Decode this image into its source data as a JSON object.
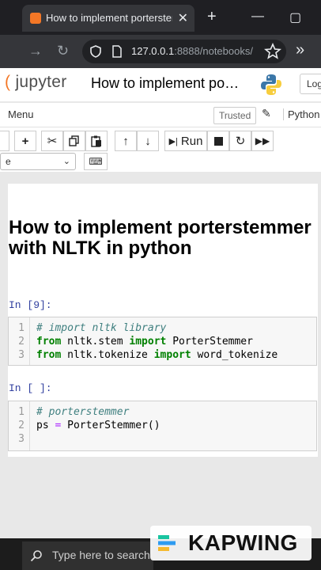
{
  "browser": {
    "tab_title": "How to implement porterstemn",
    "tab_close": "✕",
    "new_tab": "+",
    "minimize": "—",
    "maximize": "▢",
    "url_host": "127.0.0.1",
    "url_rest": ":8888/notebooks/",
    "more": "»"
  },
  "jupyter": {
    "logo_text": "jupyter",
    "notebook_title": "How to implement po…",
    "logout_label": "Log",
    "menu_label": "Menu",
    "trusted_label": "Trusted",
    "kernel_label": "Python",
    "toolbar": {
      "run_label": "Run",
      "celltype_value": "e"
    }
  },
  "notebook": {
    "heading": "How to implement porterstemmer with NLTK in python",
    "cell1": {
      "prompt": "In [9]:",
      "lines": [
        {
          "n": "1",
          "comment": "# import nltk library"
        },
        {
          "n": "2",
          "kw1": "from",
          "mid1": " nltk.stem ",
          "kw2": "import",
          "rest": " PorterStemmer"
        },
        {
          "n": "3",
          "kw1": "from",
          "mid1": " nltk.tokenize ",
          "kw2": "import",
          "rest": " word_tokenize"
        }
      ]
    },
    "cell2": {
      "prompt": "In [ ]:",
      "lines": [
        {
          "n": "1",
          "comment": "# porterstemmer"
        },
        {
          "n": "2",
          "pre": "ps ",
          "op": "=",
          "rest": " PorterStemmer()"
        },
        {
          "n": "3",
          "text": ""
        }
      ]
    }
  },
  "taskbar": {
    "search_placeholder": "Type here to search"
  },
  "watermark": {
    "text": "KAPWING"
  }
}
